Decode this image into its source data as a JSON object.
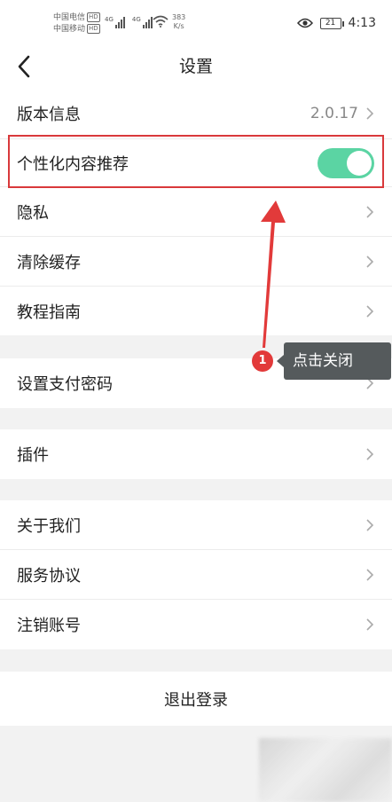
{
  "status_bar": {
    "carrier1": "中国电信",
    "carrier2": "中国移动",
    "hd": "HD",
    "net1": "4G",
    "net2": "4G",
    "speed_value": "383",
    "speed_unit": "K/s",
    "battery": "21",
    "time": "4:13"
  },
  "nav": {
    "title": "设置",
    "back_icon": "chevron-left-icon"
  },
  "settings": {
    "version": {
      "label": "版本信息",
      "value": "2.0.17"
    },
    "personalized": {
      "label": "个性化内容推荐",
      "toggle_on": true
    },
    "privacy": {
      "label": "隐私"
    },
    "clear_cache": {
      "label": "清除缓存"
    },
    "tutorial": {
      "label": "教程指南"
    },
    "payment_password": {
      "label": "设置支付密码"
    },
    "plugins": {
      "label": "插件"
    },
    "about": {
      "label": "关于我们"
    },
    "service": {
      "label": "服务协议"
    },
    "cancel_account": {
      "label": "注销账号"
    },
    "logout": {
      "label": "退出登录"
    }
  },
  "annotation": {
    "step": "1",
    "text": "点击关闭"
  },
  "colors": {
    "toggle_on": "#5bd4a3",
    "highlight": "#d9393b",
    "arrow": "#e23a3a",
    "tooltip_bg": "#555a5c"
  }
}
